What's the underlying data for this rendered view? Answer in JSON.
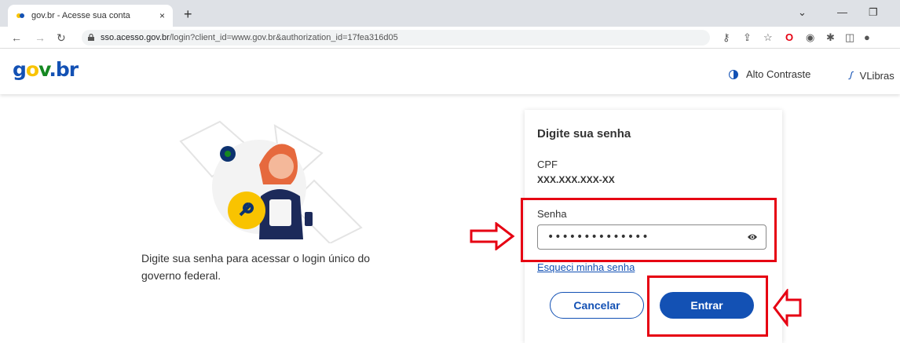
{
  "browser": {
    "tab_title": "gov.br - Acesse sua conta",
    "tab_close": "×",
    "new_tab": "+",
    "url_host": "sso.acesso.gov.br",
    "url_path": "/login?client_id=www.gov.br&authorization_id=17fea316d05"
  },
  "header": {
    "logo_g": "g",
    "logo_o": "o",
    "logo_v": "v",
    "logo_br": ".br",
    "high_contrast": "Alto Contraste",
    "vlibras": "VLibras"
  },
  "main": {
    "description": "Digite sua senha para acessar o login único do governo federal."
  },
  "login_card": {
    "title": "Digite sua senha",
    "cpf_label": "CPF",
    "cpf_value": "XXX.XXX.XXX-XX",
    "password_label": "Senha",
    "password_value": "••••••••••••••",
    "forgot_link": "Esqueci minha senha",
    "cancel_button": "Cancelar",
    "enter_button": "Entrar"
  },
  "colors": {
    "brand_blue": "#1351b4",
    "brand_yellow": "#f9c300",
    "brand_green": "#168821",
    "highlight_red": "#e60012"
  }
}
